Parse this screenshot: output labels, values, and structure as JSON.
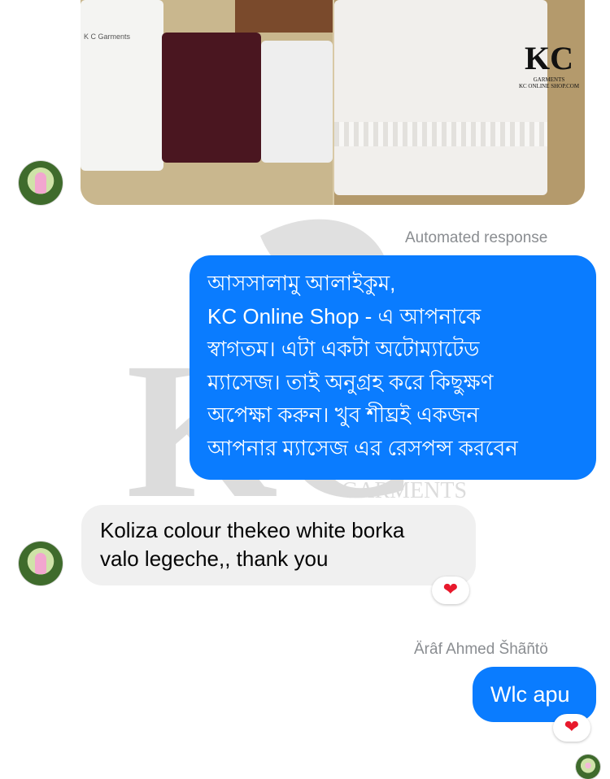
{
  "watermark": {
    "brand": "KC",
    "subtitle": "GARMENTS",
    "site": "KCONLINESHOP.COM"
  },
  "product_image": {
    "logo": "KC",
    "logo_sub": "GARMENTS",
    "logo_site": "KC ONLINE SHOP.COM",
    "package_label": "K C Garments"
  },
  "automated_label": "Automated response",
  "auto_message": {
    "lines": [
      "আসসালামু আলাইকুম,",
      "KC Online Shop - এ আপনাকে",
      "স্বাগতম। এটা একটা অটোম্যাটেড",
      "ম্যাসেজ। তাই অনুগ্রহ করে কিছুক্ষণ",
      "অপেক্ষা করুন। খুব শীঘ্রই একজন",
      "আপনার ম্যাসেজ এর রেসপন্স করবেন"
    ]
  },
  "customer_message": {
    "lines": [
      "Koliza colour thekeo white borka",
      "valo legeche,, thank you"
    ],
    "reaction": "heart-icon"
  },
  "sender_name": "Ärâf Ahmed Šhãñtö",
  "reply_message": {
    "text": "Wlc apu",
    "reaction": "heart-icon"
  },
  "colors": {
    "outgoing": "#0a7cff",
    "incoming": "#f0f0f0",
    "meta": "#8a8d91",
    "heart": "#e8192c"
  }
}
